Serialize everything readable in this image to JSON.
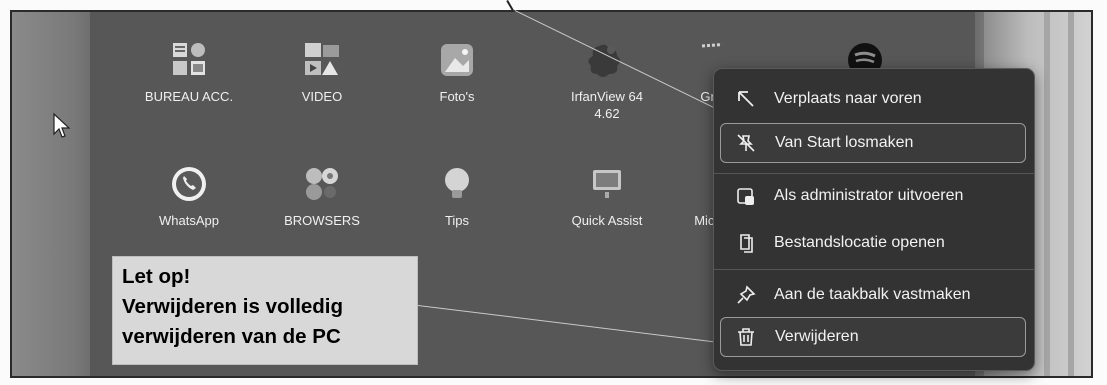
{
  "apps_row1": [
    {
      "label": "BUREAU ACC.",
      "icon": "folder-grid-icon"
    },
    {
      "label": "VIDEO",
      "icon": "video-folder-icon"
    },
    {
      "label": "Foto's",
      "icon": "photos-icon"
    },
    {
      "label": "IrfanView 64\n4.62",
      "label_line1": "IrfanView 64",
      "label_line2": "4.62",
      "icon": "irfanview-icon"
    },
    {
      "label": "Gre",
      "icon": "greenshot-icon"
    },
    {
      "label": "",
      "icon": "spotify-icon"
    }
  ],
  "apps_row2": [
    {
      "label": "WhatsApp",
      "icon": "whatsapp-icon"
    },
    {
      "label": "BROWSERS",
      "icon": "browsers-folder-icon"
    },
    {
      "label": "Tips",
      "icon": "tips-icon"
    },
    {
      "label": "Quick Assist",
      "icon": "quick-assist-icon"
    },
    {
      "label": "Micro",
      "icon": "microsoft-app-icon"
    }
  ],
  "context_menu": {
    "items": [
      {
        "label": "Verplaats naar voren",
        "icon": "arrow-up-left-icon"
      },
      {
        "label": "Van Start losmaken",
        "icon": "unpin-icon"
      },
      {
        "label": "Als administrator uitvoeren",
        "icon": "admin-shield-icon"
      },
      {
        "label": "Bestandslocatie openen",
        "icon": "file-location-icon"
      },
      {
        "label": "Aan de taakbalk vastmaken",
        "icon": "pin-icon"
      },
      {
        "label": "Verwijderen",
        "icon": "trash-icon"
      }
    ]
  },
  "note": {
    "line1": "Let op!",
    "line2": "Verwijderen is volledig",
    "line3": "verwijderen van de PC"
  },
  "colors": {
    "panel": "#575757",
    "menu": "#333333",
    "note_bg": "#d8d8d8"
  }
}
